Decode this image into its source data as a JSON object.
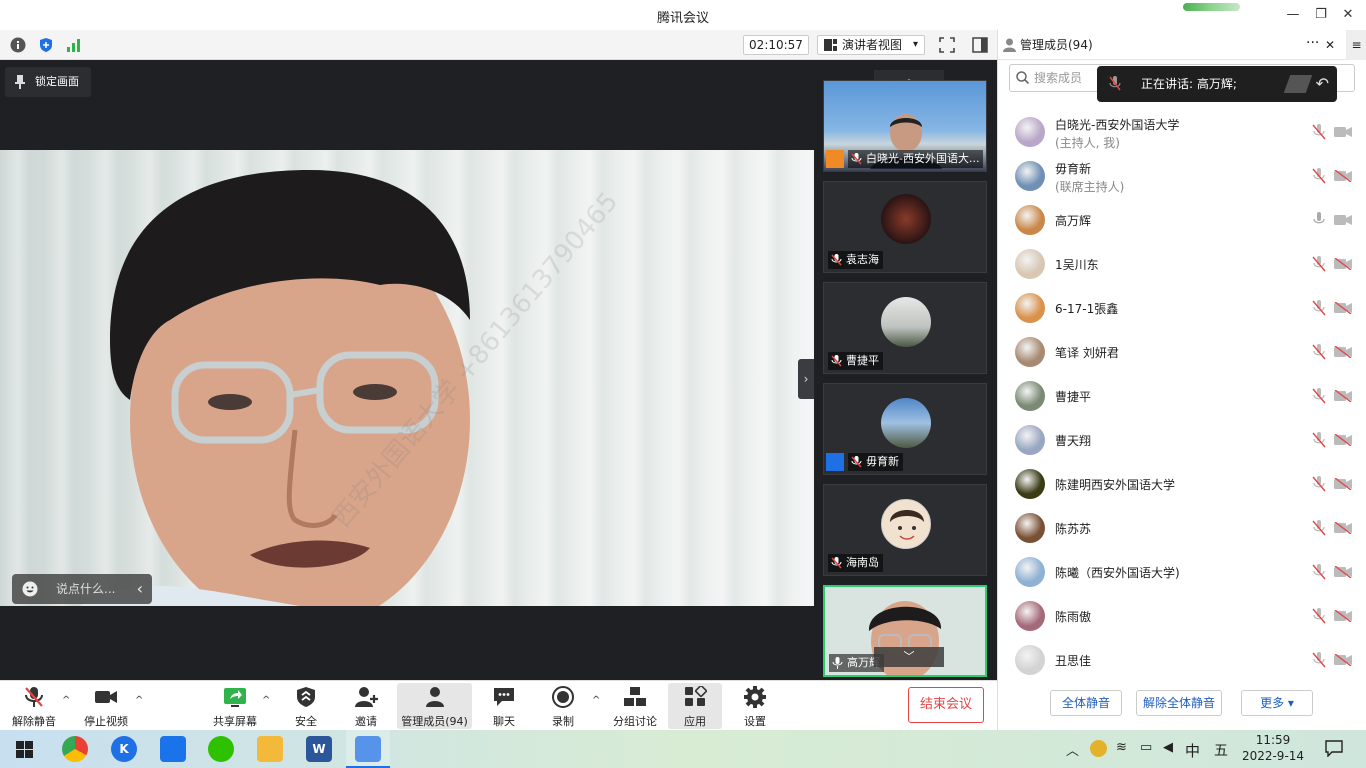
{
  "window": {
    "title": "腾讯会议",
    "minimize": "—",
    "restore": "❐",
    "close": "✕"
  },
  "toolbar": {
    "timer": "02:10:57",
    "view_label": "演讲者视图",
    "view_caret": "▾"
  },
  "stage": {
    "lock_label": "锁定画面",
    "chat_placeholder": "说点什么...",
    "chat_collapse": "‹",
    "watermark": "西安外国语大学 +8613613790465"
  },
  "thumbnails": [
    {
      "name": "白晓光-西安外国语大...",
      "muted": true,
      "host": true
    },
    {
      "name": "袁志海",
      "muted": true
    },
    {
      "name": "曹捷平",
      "muted": true
    },
    {
      "name": "毋育新",
      "muted": true,
      "cohost": true
    },
    {
      "name": "海南岛",
      "muted": true
    },
    {
      "name": "高万辉",
      "muted": false,
      "active": true
    }
  ],
  "panel": {
    "header": "管理成员(94)",
    "more": "···",
    "close": "✕",
    "search_placeholder": "搜索成员",
    "speaking_label": "正在讲话: 高万辉;",
    "members": [
      {
        "name": "白晓光-西安外国语大学",
        "role": "(主持人, 我)",
        "mic": "muted",
        "cam": "on",
        "color": "#b9a7c9"
      },
      {
        "name": "毋育新",
        "role": "(联席主持人)",
        "mic": "muted",
        "cam": "off",
        "color": "#6f8fb4"
      },
      {
        "name": "高万辉",
        "role": "",
        "mic": "on",
        "cam": "on",
        "color": "#c9884a"
      },
      {
        "name": "1吴川东",
        "role": "",
        "mic": "muted",
        "cam": "off",
        "color": "#d8c7b5"
      },
      {
        "name": "6-17-1張鑫",
        "role": "",
        "mic": "muted",
        "cam": "off",
        "color": "#d9924c"
      },
      {
        "name": "笔译 刘妍君",
        "role": "",
        "mic": "muted",
        "cam": "off",
        "color": "#a88a72"
      },
      {
        "name": "曹捷平",
        "role": "",
        "mic": "muted",
        "cam": "off",
        "color": "#7a8a74"
      },
      {
        "name": "曹天翔",
        "role": "",
        "mic": "muted",
        "cam": "off",
        "color": "#9aa7c2"
      },
      {
        "name": "陈建明西安外国语大学",
        "role": "",
        "mic": "muted",
        "cam": "off",
        "color": "#3a3a14"
      },
      {
        "name": "陈苏苏",
        "role": "",
        "mic": "muted",
        "cam": "off",
        "color": "#7a5034"
      },
      {
        "name": "陈曦（西安外国语大学)",
        "role": "",
        "mic": "muted",
        "cam": "off",
        "color": "#8fb1d4"
      },
      {
        "name": "陈雨傲",
        "role": "",
        "mic": "muted",
        "cam": "off",
        "color": "#a56a7a"
      },
      {
        "name": "丑思佳",
        "role": "",
        "mic": "muted",
        "cam": "off",
        "color": "#d3d3d3"
      }
    ],
    "mute_all": "全体静音",
    "unmute_all": "解除全体静音",
    "more_btn": "更多 ▾"
  },
  "bottom": {
    "unmute": "解除静音",
    "stop_video": "停止视频",
    "share": "共享屏幕",
    "security": "安全",
    "invite": "邀请",
    "members": "管理成员(94)",
    "chat": "聊天",
    "record": "录制",
    "breakout": "分组讨论",
    "apps": "应用",
    "settings": "设置",
    "end": "结束会议",
    "caret": "^"
  },
  "taskbar": {
    "time": "11:59",
    "date": "2022-9-14",
    "ime1": "中",
    "ime2": "五"
  },
  "colors": {
    "accent": "#1f5fbf",
    "danger": "#e54545",
    "active_border": "#2ecc71"
  }
}
